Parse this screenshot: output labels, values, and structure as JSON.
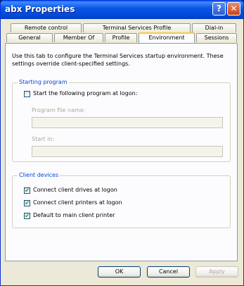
{
  "window": {
    "title": "abx Properties",
    "help_glyph": "?",
    "close_glyph": "✕"
  },
  "tabs_row1": [
    "Remote control",
    "Terminal Services Profile",
    "Dial-in"
  ],
  "tabs_row2": [
    "General",
    "Member Of",
    "Profile",
    "Environment",
    "Sessions"
  ],
  "active_tab": "Environment",
  "intro_text": "Use this tab to configure the Terminal Services startup environment. These settings override client-specified settings.",
  "starting_program": {
    "legend": "Starting program",
    "checkbox_label": "Start the following program at logon:",
    "checked": false,
    "program_label": "Program file name:",
    "program_value": "",
    "start_in_label": "Start in:",
    "start_in_value": ""
  },
  "client_devices": {
    "legend": "Client devices",
    "items": [
      {
        "label": "Connect client drives at logon",
        "checked": true
      },
      {
        "label": "Connect client printers at logon",
        "checked": true
      },
      {
        "label": "Default to main client printer",
        "checked": true
      }
    ]
  },
  "buttons": {
    "ok": "OK",
    "cancel": "Cancel",
    "apply": "Apply"
  },
  "check_glyph": "✔",
  "colors": {
    "title_bar": "#0054e3",
    "tab_highlight": "#ffc73c",
    "legend_text": "#0046d5",
    "check": "#21a121"
  }
}
